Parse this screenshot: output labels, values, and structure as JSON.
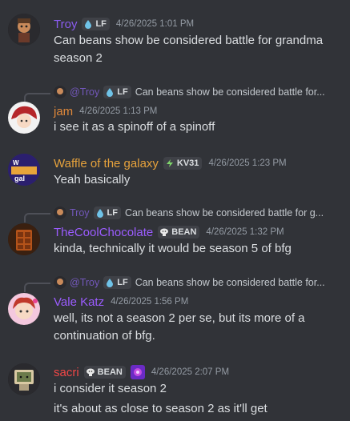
{
  "colors": {
    "background": "#313338",
    "troy": "#7c4dff",
    "jam": "#e67e22",
    "waffle": "#e6a23c",
    "coolchoc": "#9b59ff",
    "vale": "#9b59ff",
    "sacri": "#f04747"
  },
  "messages": [
    {
      "author": "Troy",
      "tag": "LF",
      "tag_icon": "water-drop-icon",
      "time": "4/26/2025 1:01 PM",
      "lines": [
        "Can beans show be considered battle for grandma",
        "season 2"
      ]
    },
    {
      "reply": {
        "author": "@Troy",
        "tag": "LF",
        "text": "Can beans show be considered battle for..."
      },
      "author": "jam",
      "time": "4/26/2025 1:13 PM",
      "lines": [
        "i see it as a spinoff of a spinoff"
      ]
    },
    {
      "author": "Waffle of the galaxy",
      "tag": "KV31",
      "tag_icon": "lightning-icon",
      "time": "4/26/2025 1:23 PM",
      "lines": [
        "Yeah basically"
      ]
    },
    {
      "reply": {
        "author": "Troy",
        "tag": "LF",
        "text": "Can beans show be considered battle for g..."
      },
      "author": "TheCoolChocolate",
      "tag": "BEAN",
      "tag_icon": "bean-icon",
      "time": "4/26/2025 1:32 PM",
      "lines": [
        "kinda, technically it would be season 5 of bfg"
      ]
    },
    {
      "reply": {
        "author": "@Troy",
        "tag": "LF",
        "text": "Can beans show be considered battle for..."
      },
      "author": "Vale Katz",
      "time": "4/26/2025 1:56 PM",
      "lines": [
        "well, its not a season 2 per se, but its more of a",
        "continuation of bfg."
      ]
    },
    {
      "author": "sacri",
      "tag": "BEAN",
      "tag_icon": "bean-icon",
      "time": "4/26/2025 2:07 PM",
      "lines": [
        "i consider it season 2",
        "it's about as close to season 2 as it'll get"
      ]
    }
  ]
}
